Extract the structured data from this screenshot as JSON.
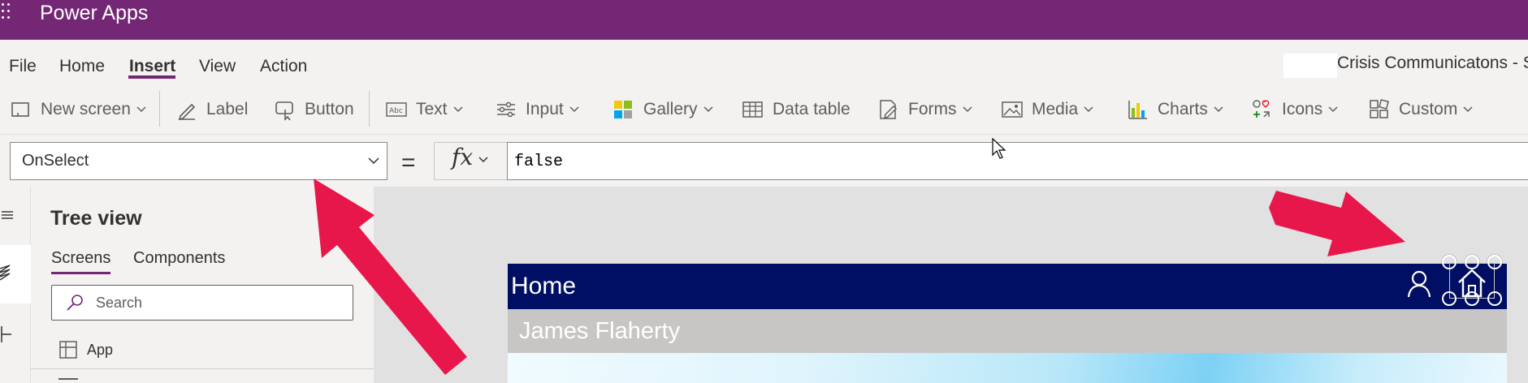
{
  "titlebar": {
    "waffle_icon": "waffle-icon",
    "app_title": "Power Apps"
  },
  "menu": {
    "tabs": [
      {
        "label": "File"
      },
      {
        "label": "Home"
      },
      {
        "label": "Insert",
        "active": true
      },
      {
        "label": "View"
      },
      {
        "label": "Action"
      }
    ],
    "doc_title": "Crisis Communicatons - S"
  },
  "ribbon": {
    "items": [
      {
        "label": "New screen",
        "icon": "new-screen-icon"
      },
      {
        "label": "Label",
        "icon": "label-icon"
      },
      {
        "label": "Button",
        "icon": "button-icon"
      },
      {
        "label": "Text",
        "icon": "text-icon"
      },
      {
        "label": "Input",
        "icon": "input-icon"
      },
      {
        "label": "Gallery",
        "icon": "gallery-icon"
      },
      {
        "label": "Data table",
        "icon": "data-table-icon"
      },
      {
        "label": "Forms",
        "icon": "forms-icon"
      },
      {
        "label": "Media",
        "icon": "media-icon"
      },
      {
        "label": "Charts",
        "icon": "charts-icon"
      },
      {
        "label": "Icons",
        "icon": "icons-icon"
      },
      {
        "label": "Custom",
        "icon": "custom-icon"
      }
    ]
  },
  "formula": {
    "property": "OnSelect",
    "equals": "=",
    "fx": "fx",
    "value": "false"
  },
  "treeview": {
    "title": "Tree view",
    "tabs": [
      {
        "label": "Screens",
        "active": true
      },
      {
        "label": "Components"
      }
    ],
    "search_placeholder": "Search",
    "items": [
      {
        "label": "App",
        "icon": "app-icon"
      }
    ]
  },
  "canvas": {
    "header_title": "Home",
    "subheader_name": "James Flaherty",
    "header_icons": [
      "person-icon",
      "home-icon"
    ]
  },
  "colors": {
    "brand": "#742774",
    "header_bar": "#000f63",
    "annotation_arrow": "#e8174b"
  }
}
